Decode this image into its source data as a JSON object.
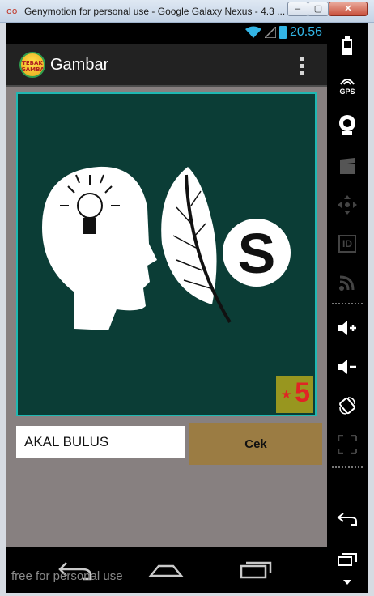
{
  "window": {
    "title": "Genymotion for personal use - Google Galaxy Nexus - 4.3 ...",
    "minimize_label": "–",
    "maximize_label": "▢",
    "close_label": "✕"
  },
  "status_bar": {
    "time": "20.56",
    "icons": [
      "wifi-icon",
      "signal-icon",
      "battery-icon"
    ],
    "accent": "#33b5e5"
  },
  "action_bar": {
    "app_logo_line1": "TEBAK",
    "app_logo_line2": "GAMBAR",
    "title": "Gambar",
    "menu_icon": "overflow-menu-icon"
  },
  "game": {
    "puzzle_image": "head-lightbulb-feather-s-icon",
    "puzzle_letter": "S",
    "score_star": "★",
    "score_value": "5",
    "answer_value": "AKAL BULUS",
    "check_button_label": "Cek",
    "colors": {
      "puzzle_bg": "#0b3d36",
      "button_bg": "#9b7c43",
      "badge_bg": "#98961f",
      "badge_text": "#e02424"
    }
  },
  "nav_bar": {
    "icons": [
      "back-icon",
      "home-icon",
      "recent-apps-icon"
    ],
    "watermark": "free for personal use"
  },
  "side_toolbar": {
    "gps_label": "GPS",
    "id_label": "ID",
    "icons": [
      "battery-icon",
      "gps-icon",
      "camera-icon",
      "clapper-icon",
      "dpad-icon",
      "id-icon",
      "cast-icon",
      "volume-up-icon",
      "volume-down-icon",
      "rotate-icon",
      "scale-icon",
      "back-icon",
      "recent-apps-icon",
      "chevron-down-icon"
    ]
  }
}
